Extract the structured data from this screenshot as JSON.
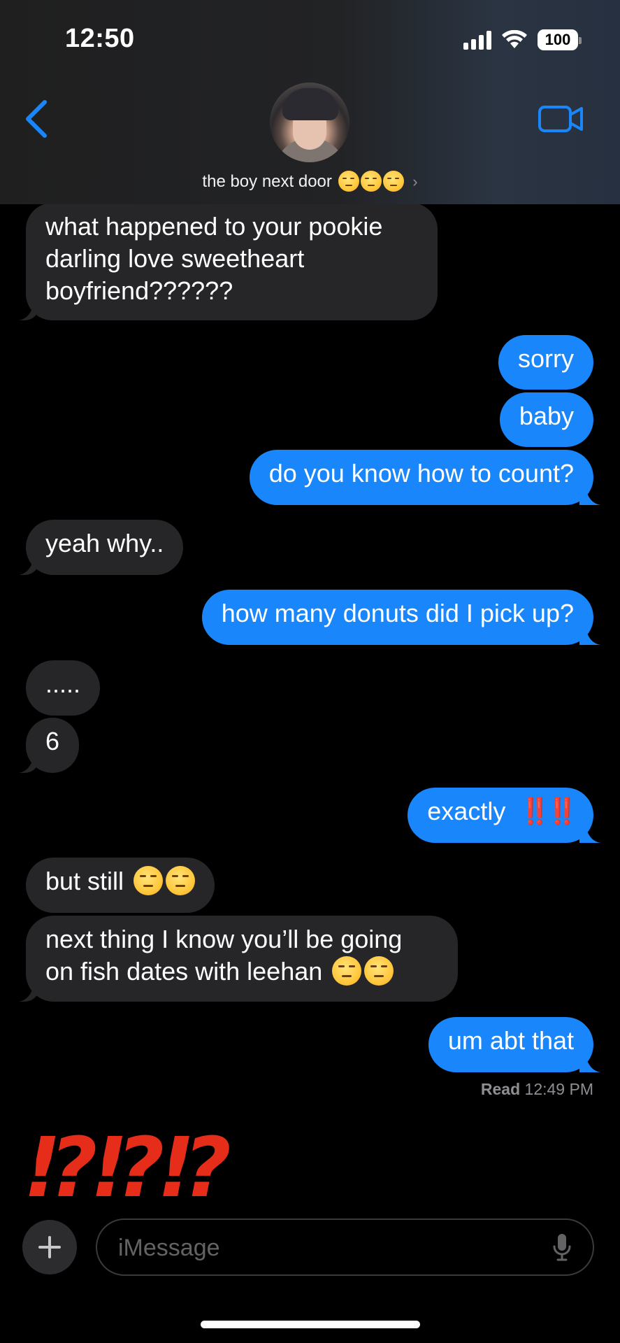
{
  "status_bar": {
    "time": "12:50",
    "battery": "100"
  },
  "header": {
    "contact_name": "the boy next door",
    "contact_emoji": "😟😟😟"
  },
  "messages": [
    {
      "from": "them",
      "lines": [
        "what happened to your pookie",
        "darling love sweetheart",
        "boyfriend??????"
      ]
    },
    {
      "from": "me",
      "text": "sorry"
    },
    {
      "from": "me",
      "text": "baby"
    },
    {
      "from": "me",
      "text": "do you know how to count?"
    },
    {
      "from": "them",
      "text": "yeah why.."
    },
    {
      "from": "me",
      "text": "how many donuts did I pick up?"
    },
    {
      "from": "them",
      "text": "....."
    },
    {
      "from": "them",
      "text": "6"
    },
    {
      "from": "me",
      "text": "exactly",
      "emoji": "‼️‼️"
    },
    {
      "from": "them",
      "text": "but still",
      "emoji": "😒😒"
    },
    {
      "from": "them",
      "lines": [
        "next thing I know you’ll be going",
        "on fish dates with leehan"
      ],
      "emoji": "😒😒"
    },
    {
      "from": "me",
      "text": "um abt that"
    }
  ],
  "read_receipt": {
    "label": "Read",
    "time": "12:49 PM"
  },
  "typed_reaction": "⁉⁉⁉",
  "composer": {
    "placeholder": "iMessage",
    "value": ""
  },
  "colors": {
    "outgoing_bubble": "#1a86fb",
    "incoming_bubble": "#262628",
    "accent": "#1a86fb",
    "interrobang": "#e52d1a"
  }
}
